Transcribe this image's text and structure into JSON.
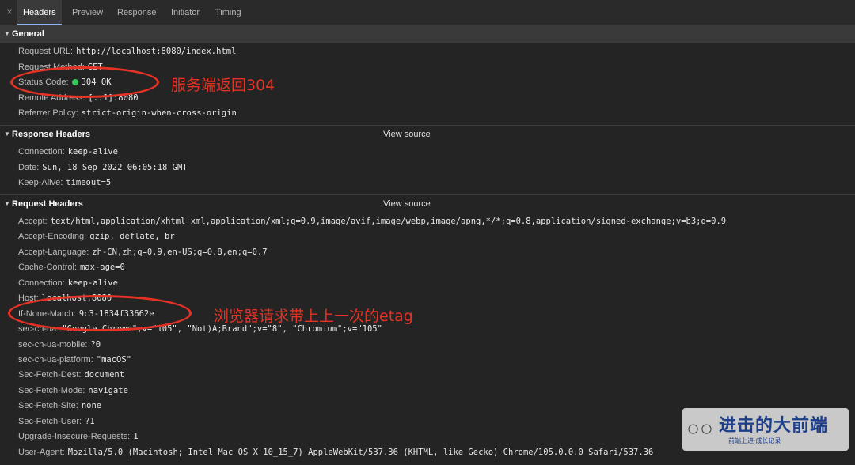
{
  "tabs": {
    "close": "×",
    "items": [
      "Headers",
      "Preview",
      "Response",
      "Initiator",
      "Timing"
    ],
    "active": "Headers"
  },
  "general": {
    "title": "General",
    "rows": [
      {
        "key": "Request URL:",
        "value": "http://localhost:8080/index.html"
      },
      {
        "key": "Request Method:",
        "value": "GET"
      },
      {
        "key": "Status Code:",
        "value": "304 OK",
        "status_color": "#34c759"
      },
      {
        "key": "Remote Address:",
        "value": "[::1]:8080"
      },
      {
        "key": "Referrer Policy:",
        "value": "strict-origin-when-cross-origin"
      }
    ]
  },
  "response_headers": {
    "title": "Response Headers",
    "view_source": "View source",
    "rows": [
      {
        "key": "Connection:",
        "value": "keep-alive"
      },
      {
        "key": "Date:",
        "value": "Sun, 18 Sep 2022 06:05:18 GMT"
      },
      {
        "key": "Keep-Alive:",
        "value": "timeout=5"
      }
    ]
  },
  "request_headers": {
    "title": "Request Headers",
    "view_source": "View source",
    "rows": [
      {
        "key": "Accept:",
        "value": "text/html,application/xhtml+xml,application/xml;q=0.9,image/avif,image/webp,image/apng,*/*;q=0.8,application/signed-exchange;v=b3;q=0.9"
      },
      {
        "key": "Accept-Encoding:",
        "value": "gzip, deflate, br"
      },
      {
        "key": "Accept-Language:",
        "value": "zh-CN,zh;q=0.9,en-US;q=0.8,en;q=0.7"
      },
      {
        "key": "Cache-Control:",
        "value": "max-age=0"
      },
      {
        "key": "Connection:",
        "value": "keep-alive"
      },
      {
        "key": "Host:",
        "value": "localhost:8080"
      },
      {
        "key": "If-None-Match:",
        "value": "9c3-1834f33662e"
      },
      {
        "key": "sec-ch-ua:",
        "value": "\"Google Chrome\";v=\"105\", \"Not)A;Brand\";v=\"8\", \"Chromium\";v=\"105\""
      },
      {
        "key": "sec-ch-ua-mobile:",
        "value": "?0"
      },
      {
        "key": "sec-ch-ua-platform:",
        "value": "\"macOS\""
      },
      {
        "key": "Sec-Fetch-Dest:",
        "value": "document"
      },
      {
        "key": "Sec-Fetch-Mode:",
        "value": "navigate"
      },
      {
        "key": "Sec-Fetch-Site:",
        "value": "none"
      },
      {
        "key": "Sec-Fetch-User:",
        "value": "?1"
      },
      {
        "key": "Upgrade-Insecure-Requests:",
        "value": "1"
      },
      {
        "key": "User-Agent:",
        "value": "Mozilla/5.0 (Macintosh; Intel Mac OS X 10_15_7) AppleWebKit/537.36 (KHTML, like Gecko) Chrome/105.0.0.0 Safari/537.36"
      }
    ]
  },
  "annotations": {
    "status_note": "服务端返回304",
    "etag_note": "浏览器请求带上上一次的etag",
    "color": "#e53224"
  },
  "watermark": {
    "icon": "wechat-icon",
    "big": "进击的大前端",
    "small": "前端上进·成长记录"
  }
}
